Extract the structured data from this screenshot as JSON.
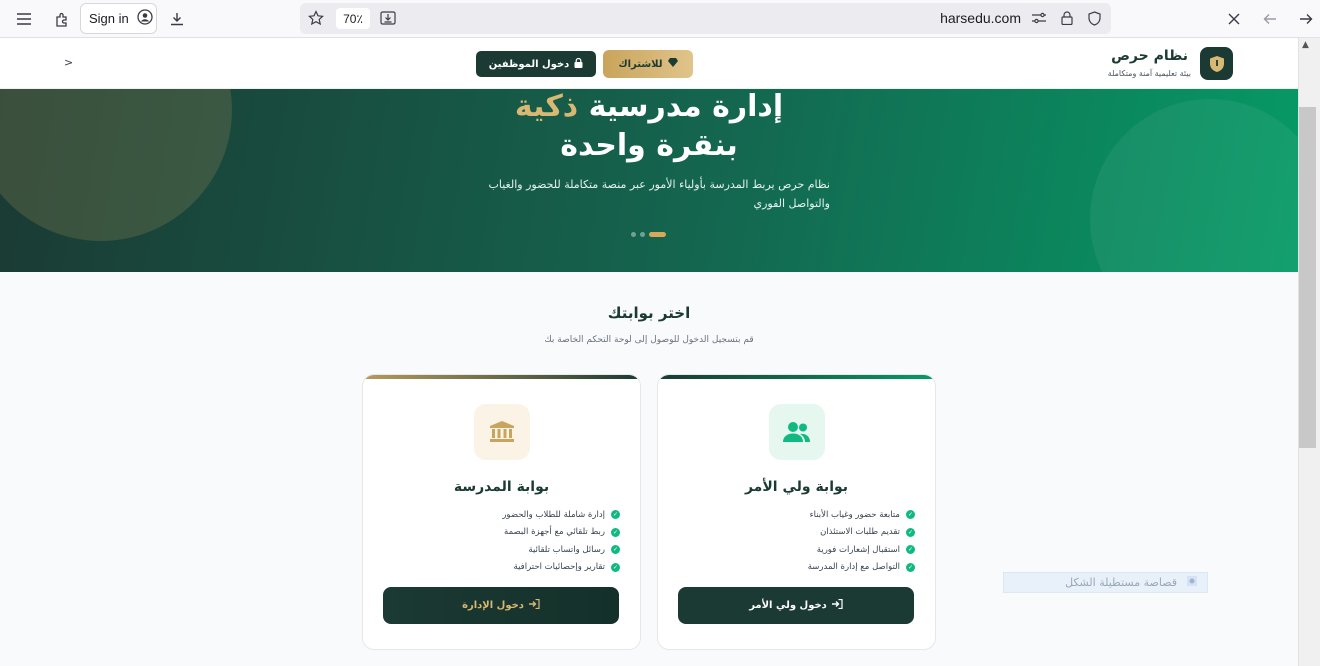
{
  "browser": {
    "signin_label": "Sign in",
    "zoom": "70٪",
    "domain": "harsedu.com"
  },
  "header": {
    "brand_name": "نظام حرص",
    "brand_tagline": "بيئة تعليمية آمنة ومتكاملة",
    "subscribe_label": "للاشتراك",
    "staff_login_label": "دخول الموظفين",
    "chevron": ">"
  },
  "hero": {
    "title_line1_a": "إدارة مدرسية",
    "title_line1_b": "ذكية",
    "title_line2": "بنقرة واحدة",
    "description": "نظام حرص يربط المدرسة بأولياء الأمور عبر منصة متكاملة للحضور والغياب والتواصل الفوري",
    "slides_total": 3,
    "active_slide": 1
  },
  "portals": {
    "title": "اختر بوابتك",
    "subtitle": "قم بتسجيل الدخول للوصول إلى لوحة التحكم الخاصة بك",
    "parent": {
      "title": "بوابة ولي الأمر",
      "features": [
        "متابعة حضور وغياب الأبناء",
        "تقديم طلبات الاستئذان",
        "استقبال إشعارات فورية",
        "التواصل مع إدارة المدرسة"
      ],
      "button_label": "دخول ولي الأمر"
    },
    "school": {
      "title": "بوابة المدرسة",
      "features": [
        "إدارة شاملة للطلاب والحضور",
        "ربط تلقائي مع أجهزة البصمة",
        "رسائل واتساب تلقائية",
        "تقارير وإحصائيات احترافية"
      ],
      "button_label": "دخول الإدارة"
    }
  },
  "widget": {
    "label": "قصاصة مستطيلة الشكل"
  },
  "colors": {
    "primary": "#1b3a33",
    "gold": "#d8b873",
    "green": "#10b981"
  }
}
